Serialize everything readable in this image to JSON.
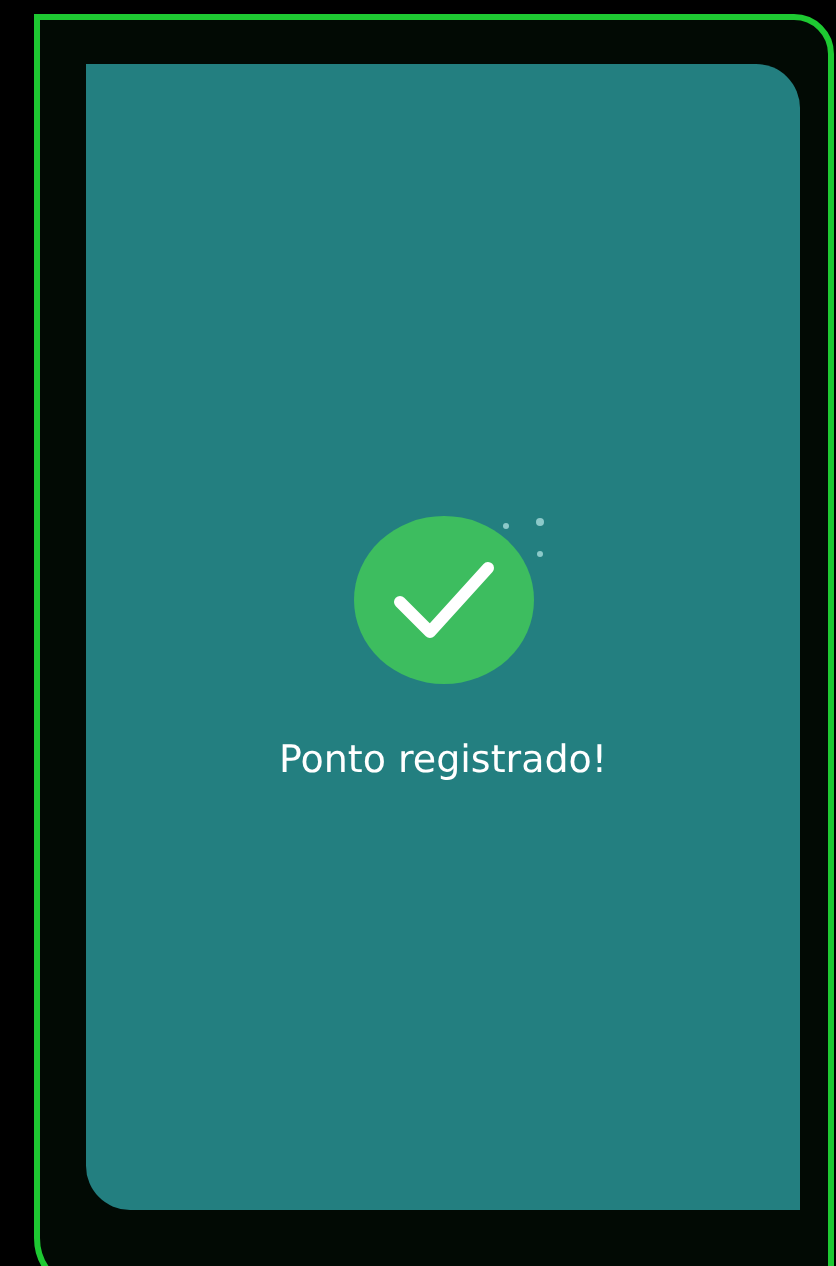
{
  "confirmation": {
    "message": "Ponto registrado!"
  }
}
